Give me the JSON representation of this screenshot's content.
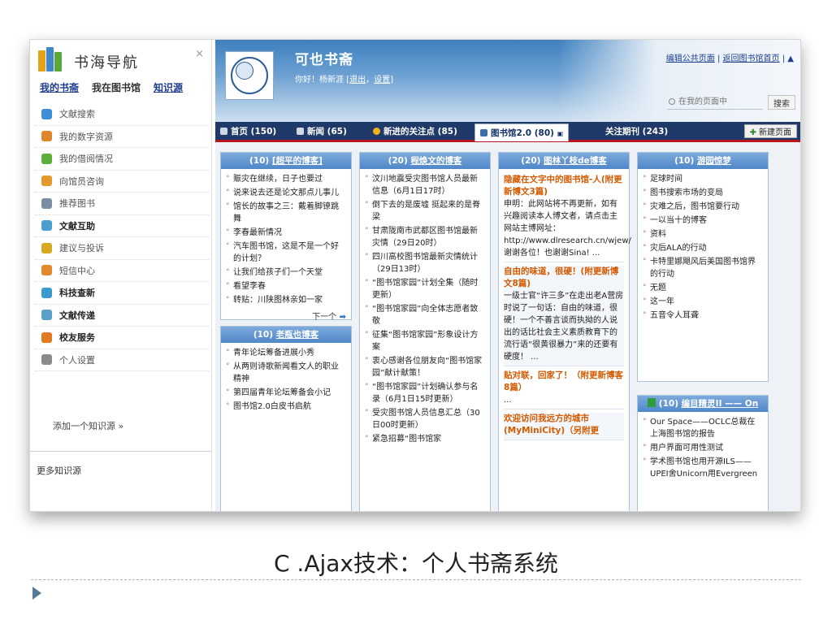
{
  "sidebar": {
    "title": "书海导航",
    "close_label": "×",
    "tabs": [
      "我的书斋",
      "我在图书馆",
      "知识源"
    ],
    "items": [
      {
        "label": "文献搜索",
        "icon": "magnifier-globe-icon",
        "color": "#3d8fd8",
        "bold": false
      },
      {
        "label": "我的数字资源",
        "icon": "people-icon",
        "color": "#e0862a",
        "bold": false
      },
      {
        "label": "我的借阅情况",
        "icon": "book-hand-icon",
        "color": "#5ab03a",
        "bold": false
      },
      {
        "label": "向馆员咨询",
        "icon": "person-icon",
        "color": "#e29a2e",
        "bold": false
      },
      {
        "label": "推荐图书",
        "icon": "book-icon",
        "color": "#7a8fa6",
        "bold": false
      },
      {
        "label": "文献互助",
        "icon": "exchange-icon",
        "color": "#4a9fd0",
        "bold": true
      },
      {
        "label": "建议与投诉",
        "icon": "pencil-icon",
        "color": "#d8a820",
        "bold": false
      },
      {
        "label": "短信中心",
        "icon": "message-icon",
        "color": "#e08a2a",
        "bold": false
      },
      {
        "label": "科技查新",
        "icon": "globe-icon",
        "color": "#3a9ad0",
        "bold": true
      },
      {
        "label": "文献传递",
        "icon": "document-icon",
        "color": "#5aa0c8",
        "bold": true
      },
      {
        "label": "校友服务",
        "icon": "users-icon",
        "color": "#e07a20",
        "bold": true
      },
      {
        "label": "个人设置",
        "icon": "user-settings-icon",
        "color": "#8a8a8a",
        "bold": false
      }
    ],
    "add_source": "添加一个知识源 »",
    "more_sources": "更多知识源"
  },
  "header": {
    "site_title": "可也书斋",
    "greeting_prefix": "你好！杨新涯 [",
    "logout": "退出",
    "sep": "，",
    "settings": "设置",
    "greeting_suffix": "]",
    "edit_public": "编辑公共页面",
    "back_home": "返回图书馆首页",
    "search_placeholder": "在我的页面中",
    "search_button": "搜索"
  },
  "tabs": [
    {
      "label": "首页 (150)",
      "icon": "home-icon",
      "color": "#cfd8e6",
      "active": false
    },
    {
      "label": "新闻 (65)",
      "icon": "monitor-icon",
      "color": "#cfd8e6",
      "active": false
    },
    {
      "label": "新进的关注点 (85)",
      "icon": "smiley-icon",
      "color": "#f2b21e",
      "active": false
    },
    {
      "label": "图书馆2.0 (80)",
      "icon": "book-tab-icon",
      "color": "#3d6fb0",
      "active": true
    },
    {
      "label": "关注期刊 (243)",
      "icon": "",
      "color": "",
      "active": false
    }
  ],
  "new_page_button": "新建页面",
  "widgets": {
    "w1": {
      "count": "(10)",
      "title": "[超平的博客]",
      "items": [
        "赈灾在继续，日子也要过",
        "说来说去还是论文那点儿事儿",
        "馆长的故事之三：戴着脚镣跳舞",
        "李春最新情况",
        "汽车图书馆，这是不是一个好的计划？",
        "让我们给孩子们一个天堂",
        "看望李春",
        "转贴：川陕图林亲如一家"
      ],
      "next": "下一个"
    },
    "w2": {
      "count": "(10)",
      "title": "老瓶也博客",
      "items": [
        "青年论坛筹备进展小秀",
        "从两则诗歌新闻看文人的职业精神",
        "第四届青年论坛筹备会小记",
        "图书馆2.0白皮书启航"
      ]
    },
    "w3": {
      "count": "(20)",
      "title": "程焕文的博客",
      "items": [
        "汶川地震受灾图书馆人员最新信息（6月1日17时）",
        "倒下去的是废墟 挺起来的是脊梁",
        "甘肃陇南市武都区图书馆最新灾情（29日20时）",
        "四川高校图书馆最新灾情统计（29日13时）",
        "“图书馆家园”计划全集（随时更新）",
        "“图书馆家园”向全体志愿者致敬",
        "征集“图书馆家园”形象设计方案",
        "衷心感谢各位朋友向“图书馆家园”献计献策！",
        "“图书馆家园”计划确认参与名录（6月1日15时更新）",
        "受灾图书馆人员信息汇总（30日00时更新）",
        "紧急招募“图书馆家"
      ]
    },
    "w4": {
      "count": "(20)",
      "title": "图林丫枝de博客",
      "posts": [
        {
          "title": "隐藏在文字中的图书馆-人(附更新博文3篇)",
          "text": "申明：此网站将不再更新，如有兴趣阅读本人博文者，请点击主网站主博网址：http://www.dlresearch.cn/wjew/ 谢谢各位！也谢谢Sina! ..."
        },
        {
          "title": "自由的味道，很硬！(附更新博文8篇)",
          "text": "一级士官“许三多”在走出老A营房时说了一句话：自由的味道，很硬！一个不善言谈而执拗的人说出的话比社会主义素质教育下的流行语“很黄很暴力”来的还要有硬度！ ..."
        },
        {
          "title": "贴对联，回家了！（附更新博客8篇）",
          "text": "..."
        },
        {
          "title": "欢迎访问我远方的城市(MyMiniCity)（另附更",
          "text": ""
        }
      ]
    },
    "w5": {
      "count": "(10)",
      "title": "游园惊梦",
      "items": [
        "足球时间",
        "图书搜索市场的变局",
        "灾难之后，图书馆要行动",
        "一以当十的博客",
        "资料",
        "灾后ALA的行动",
        "卡特里娜飓风后美国图书馆界的行动",
        "无题",
        "这一年",
        "五音令人耳聋"
      ]
    },
    "w6": {
      "count": "(10)",
      "title": "编目精灵II —— On",
      "items": [
        "Our Space——OCLC总裁在上海图书馆的报告",
        "用户界面可用性测试",
        "学术图书馆也用开源ILS——UPEI舍Unicorn用Evergreen"
      ]
    }
  },
  "slide": {
    "caption": "C .Ajax技术：个人书斋系统"
  }
}
